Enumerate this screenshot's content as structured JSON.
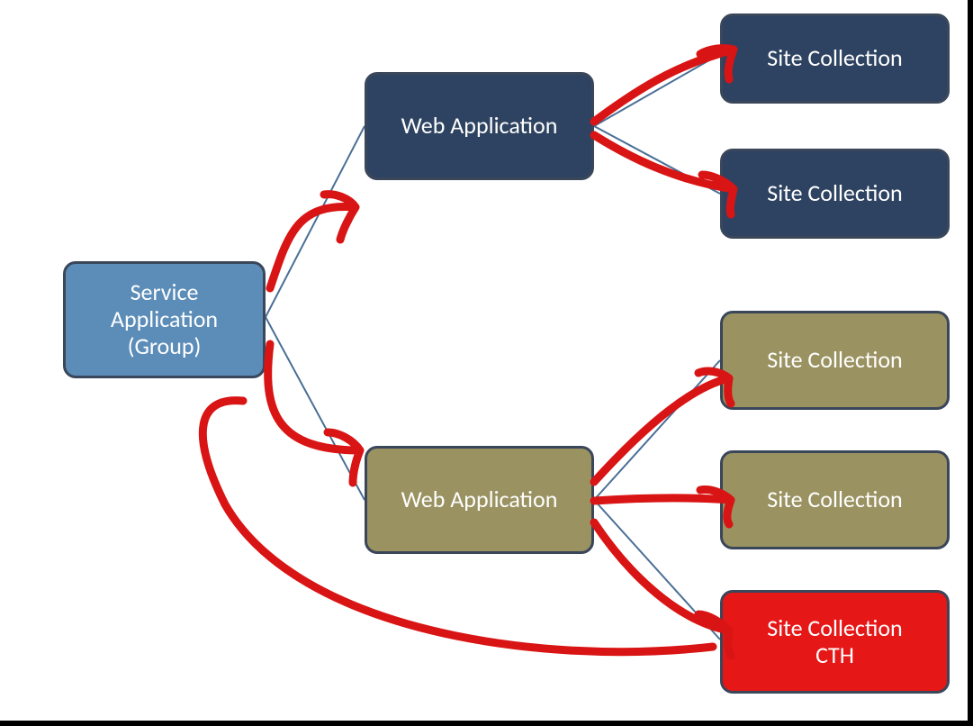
{
  "nodes": {
    "root": {
      "label": "Service\nApplication\n(Group)"
    },
    "webA": {
      "label": "Web Application"
    },
    "webB": {
      "label": "Web Application"
    },
    "scA1": {
      "label": "Site Collection"
    },
    "scA2": {
      "label": "Site Collection"
    },
    "scB1": {
      "label": "Site Collection"
    },
    "scB2": {
      "label": "Site Collection"
    },
    "scCTH": {
      "label": "Site Collection\nCTH"
    }
  },
  "colors": {
    "blueLight": "#5b8db8",
    "blueDark": "#2e4361",
    "olive": "#9a9261",
    "red": "#e61717",
    "connector": "#4a6f96",
    "scribble": "#d91414",
    "border": "#3a465a"
  },
  "edges": [
    [
      "root",
      "webA"
    ],
    [
      "root",
      "webB"
    ],
    [
      "webA",
      "scA1"
    ],
    [
      "webA",
      "scA2"
    ],
    [
      "webB",
      "scB1"
    ],
    [
      "webB",
      "scB2"
    ],
    [
      "webB",
      "scCTH"
    ]
  ],
  "annotations": "Hand-drawn red arrows linking root→webA, root→webB, webA→scA1, webA→scA2, webB→scB1, webB→scB2, webB→scCTH, plus a large loop from scCTH back toward root."
}
